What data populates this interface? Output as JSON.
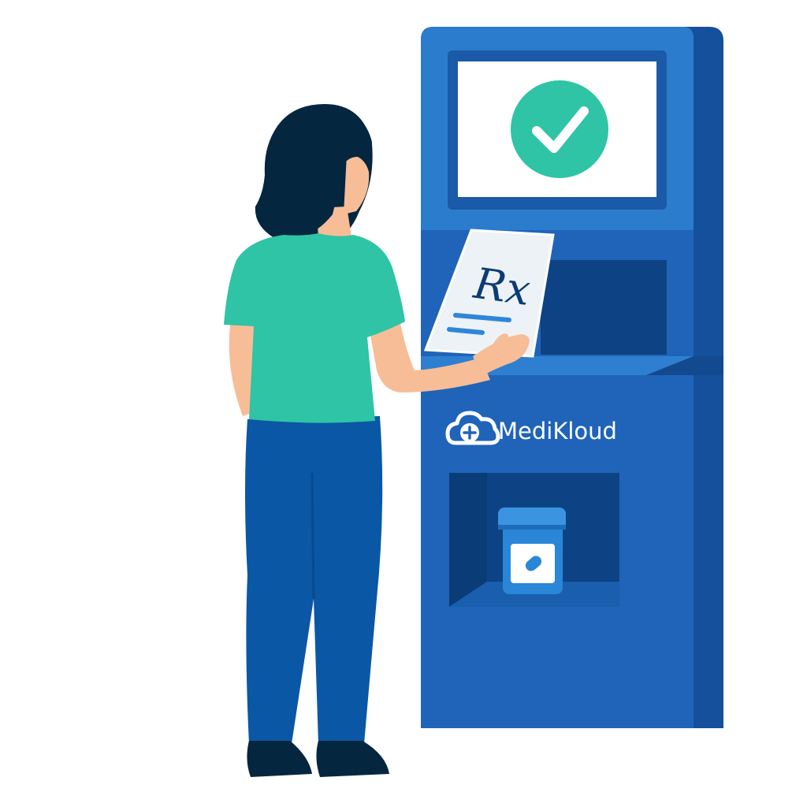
{
  "kiosk": {
    "brand_name": "MediKloud",
    "brand_icon": "cloud-plus-icon",
    "screen_status_icon": "checkmark-icon",
    "prescription_label": "Rx",
    "dispensed_item_icon": "pill-bottle-icon"
  },
  "colors": {
    "kiosk_body": "#1f64b8",
    "kiosk_side": "#14509c",
    "kiosk_panel": "#2a7ccc",
    "screen": "#ffffff",
    "check_green": "#2ec4a5",
    "shirt": "#2ec4a5",
    "pants": "#0a57a6",
    "hair": "#05263f",
    "skin": "#f7bd97",
    "rx_ink": "#0c3c74",
    "rx_lines": "#2e86d8"
  }
}
